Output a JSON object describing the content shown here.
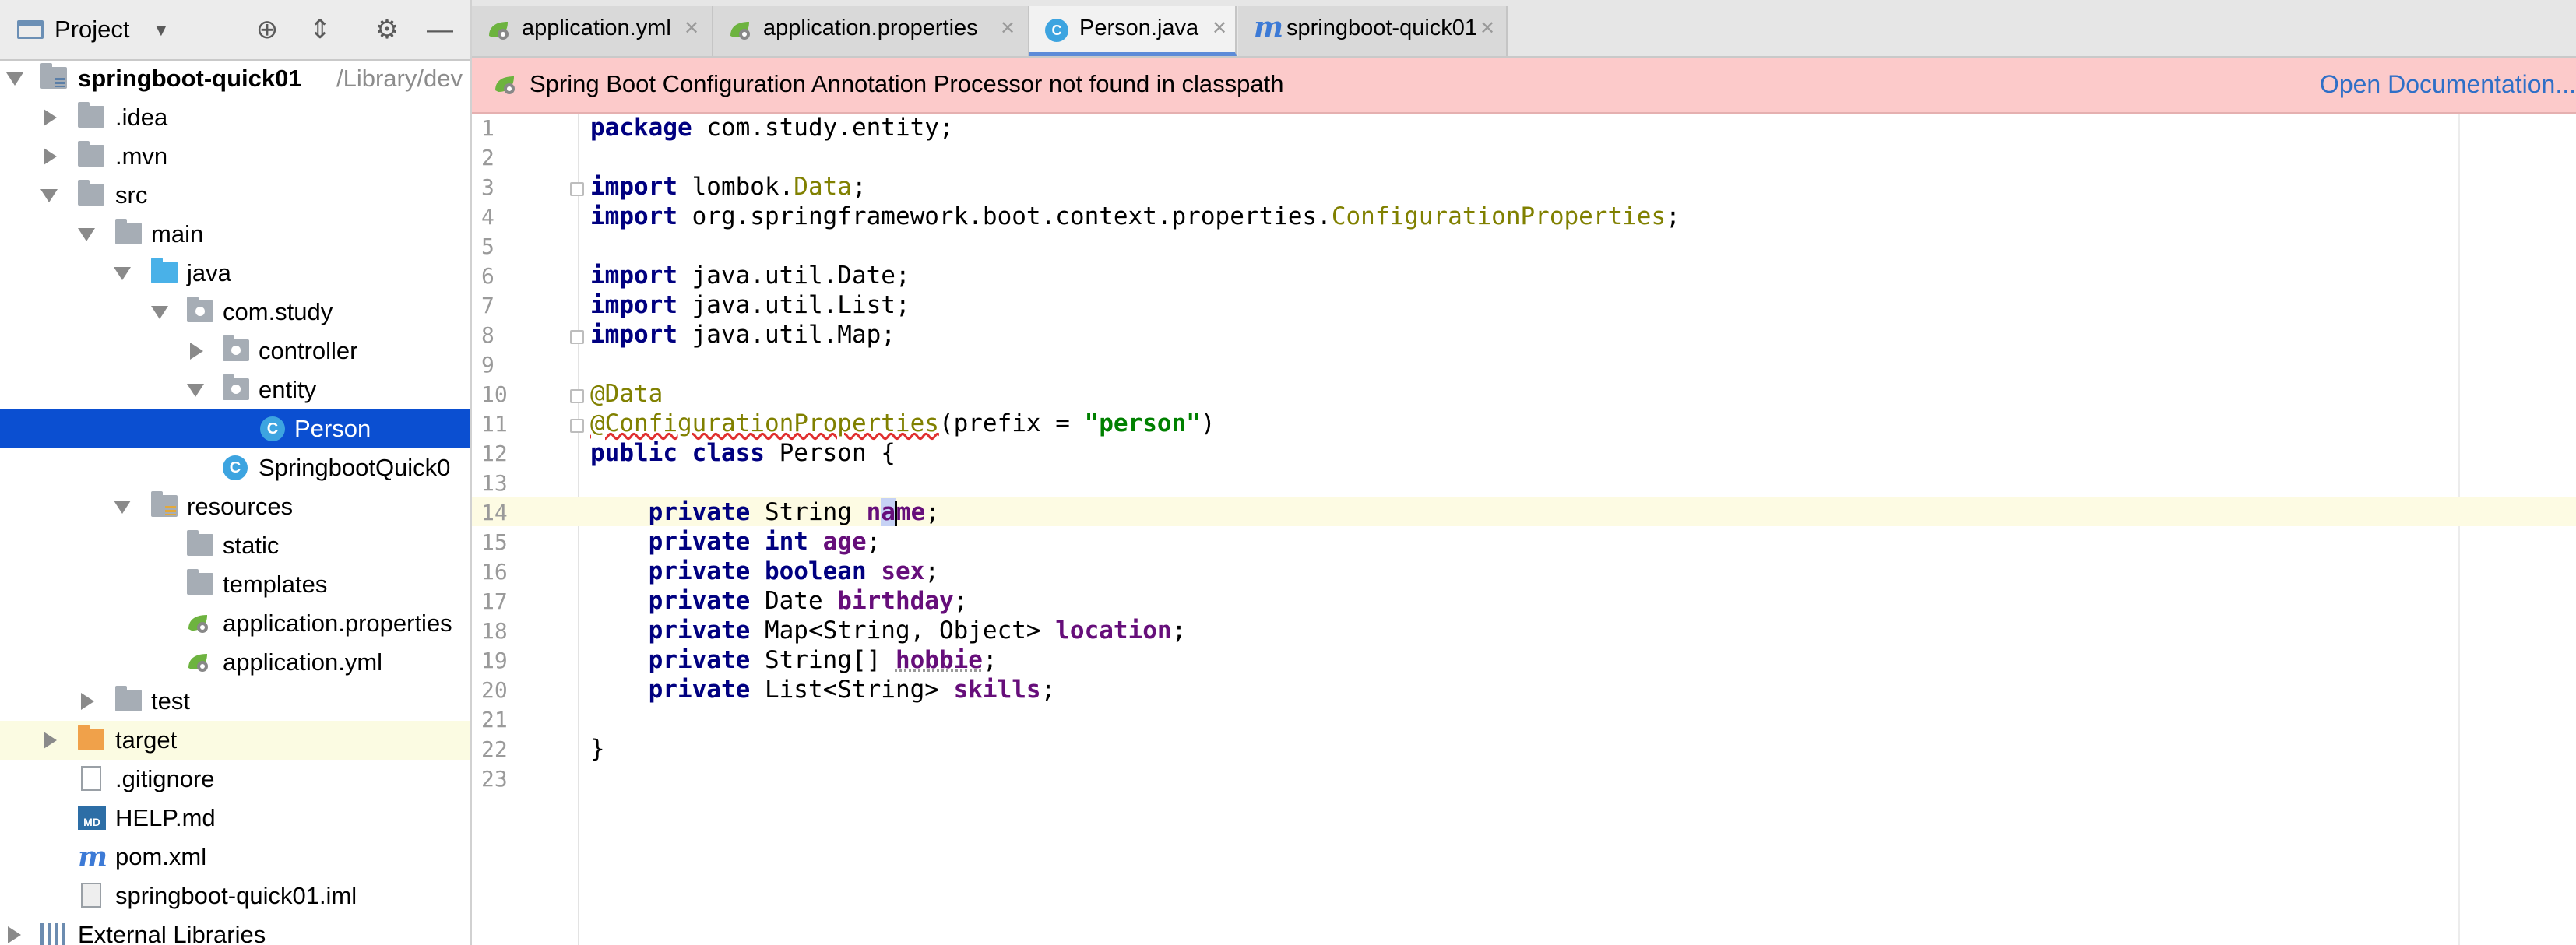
{
  "sidebar": {
    "title": "Project",
    "tree": [
      {
        "label": "springboot-quick01",
        "path": "/Library/dev",
        "icon": "module-folder-icon",
        "expanded": true
      },
      {
        "label": ".idea",
        "icon": "folder-icon",
        "expanded": false
      },
      {
        "label": ".mvn",
        "icon": "folder-icon",
        "expanded": false
      },
      {
        "label": "src",
        "icon": "folder-icon",
        "expanded": true
      },
      {
        "label": "main",
        "icon": "folder-icon",
        "expanded": true
      },
      {
        "label": "java",
        "icon": "source-folder-icon",
        "expanded": true
      },
      {
        "label": "com.study",
        "icon": "package-icon",
        "expanded": true
      },
      {
        "label": "controller",
        "icon": "package-icon",
        "expanded": false
      },
      {
        "label": "entity",
        "icon": "package-icon",
        "expanded": true
      },
      {
        "label": "Person",
        "icon": "java-class-icon",
        "selected": true
      },
      {
        "label": "SpringbootQuick0",
        "icon": "spring-boot-class-icon"
      },
      {
        "label": "resources",
        "icon": "resources-folder-icon",
        "expanded": true
      },
      {
        "label": "static",
        "icon": "folder-icon"
      },
      {
        "label": "templates",
        "icon": "folder-icon"
      },
      {
        "label": "application.properties",
        "icon": "spring-config-icon"
      },
      {
        "label": "application.yml",
        "icon": "spring-config-icon"
      },
      {
        "label": "test",
        "icon": "folder-icon",
        "expanded": false
      },
      {
        "label": "target",
        "icon": "excluded-folder-icon",
        "expanded": false
      },
      {
        "label": ".gitignore",
        "icon": "file-icon"
      },
      {
        "label": "HELP.md",
        "icon": "markdown-icon"
      },
      {
        "label": "pom.xml",
        "icon": "maven-icon"
      },
      {
        "label": "springboot-quick01.iml",
        "icon": "iml-file-icon"
      },
      {
        "label": "External Libraries",
        "icon": "libraries-icon",
        "expanded": false
      }
    ]
  },
  "tabs": [
    {
      "label": "application.yml",
      "icon": "spring-config-icon"
    },
    {
      "label": "application.properties",
      "icon": "spring-config-icon"
    },
    {
      "label": "Person.java",
      "icon": "java-class-icon",
      "active": true
    },
    {
      "label": "springboot-quick01",
      "icon": "maven-icon"
    }
  ],
  "banner": {
    "message": "Spring Boot Configuration Annotation Processor not found in classpath",
    "link": "Open Documentation..."
  },
  "editor": {
    "caret_line": 14,
    "lines": [
      "package com.study.entity;",
      "",
      "import lombok.Data;",
      "import org.springframework.boot.context.properties.ConfigurationProperties;",
      "",
      "import java.util.Date;",
      "import java.util.List;",
      "import java.util.Map;",
      "",
      "@Data",
      "@ConfigurationProperties(prefix = \"person\")",
      "public class Person {",
      "",
      "    private String name;",
      "    private int age;",
      "    private boolean sex;",
      "    private Date birthday;",
      "    private Map<String, Object> location;",
      "    private String[] hobbie;",
      "    private List<String> skills;",
      "",
      "}",
      ""
    ]
  },
  "colors": {
    "keyword": "#000080",
    "annotation": "#808000",
    "string": "#008000",
    "field": "#660e7a",
    "selection": "#0b4fd1",
    "banner": "#fccaca"
  }
}
